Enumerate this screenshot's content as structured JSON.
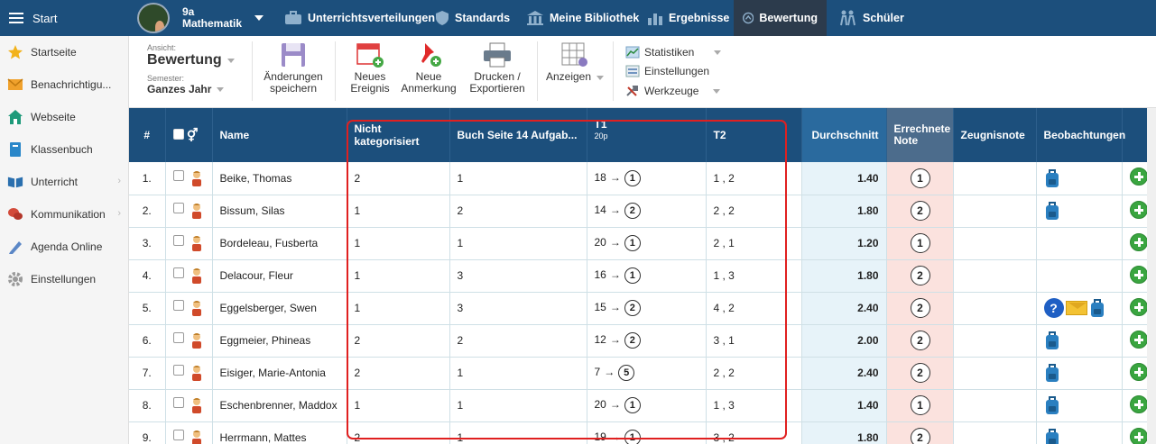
{
  "topbar": {
    "start_label": "Start",
    "class_line1": "9a",
    "class_line2": "Mathematik",
    "nav": [
      {
        "label": "Unterrichtsverteilungen",
        "icon": "briefcase-icon"
      },
      {
        "label": "Standards",
        "icon": "shield-icon"
      },
      {
        "label": "Meine Bibliothek",
        "icon": "library-icon"
      },
      {
        "label": "Ergebnisse",
        "icon": "bar-chart-icon"
      },
      {
        "label": "Bewertung",
        "icon": "gauge-icon",
        "active": true
      },
      {
        "label": "Schüler",
        "icon": "students-icon"
      }
    ]
  },
  "sidebar": {
    "items": [
      {
        "label": "Startseite",
        "icon": "star-icon"
      },
      {
        "label": "Benachrichtigu...",
        "icon": "envelope-icon"
      },
      {
        "label": "Webseite",
        "icon": "house-icon"
      },
      {
        "label": "Klassenbuch",
        "icon": "book-icon"
      },
      {
        "label": "Unterricht",
        "icon": "open-book-icon"
      },
      {
        "label": "Kommunikation",
        "icon": "chat-icon"
      },
      {
        "label": "Agenda Online",
        "icon": "pen-icon"
      },
      {
        "label": "Einstellungen",
        "icon": "gear-icon"
      }
    ]
  },
  "toolbar": {
    "ansicht_label": "Ansicht:",
    "ansicht_value": "Bewertung",
    "semester_label": "Semester:",
    "semester_value": "Ganzes Jahr",
    "save_line1": "Änderungen",
    "save_line2": "speichern",
    "event_line1": "Neues",
    "event_line2": "Ereignis",
    "note_line1": "Neue",
    "note_line2": "Anmerkung",
    "print_line1": "Drucken /",
    "print_line2": "Exportieren",
    "view_label": "Anzeigen",
    "stats_label": "Statistiken",
    "settings_label": "Einstellungen",
    "tools_label": "Werkzeuge"
  },
  "table": {
    "headers": {
      "num": "#",
      "name": "Name",
      "nk": "Nicht kategorisiert",
      "buch": "Buch Seite 14 Aufgab...",
      "t1": "T1",
      "t1_sub": "20p",
      "t2": "T2",
      "avg": "Durchschnitt",
      "calc_line1": "Errechnete",
      "calc_line2": "Note",
      "zeugnis": "Zeugnisnote",
      "beob": "Beobachtungen"
    },
    "rows": [
      {
        "num": "1.",
        "name": "Beike, Thomas",
        "nk": "2",
        "buch": "1",
        "t1_pts": "18",
        "t1_grade": "1",
        "t2": "1 , 2",
        "avg": "1.40",
        "calc": "1",
        "obs": [
          "bag"
        ]
      },
      {
        "num": "2.",
        "name": "Bissum, Silas",
        "nk": "1",
        "buch": "2",
        "t1_pts": "14",
        "t1_grade": "2",
        "t2": "2 , 2",
        "avg": "1.80",
        "calc": "2",
        "obs": [
          "bag"
        ]
      },
      {
        "num": "3.",
        "name": "Bordeleau, Fusberta",
        "nk": "1",
        "buch": "1",
        "t1_pts": "20",
        "t1_grade": "1",
        "t2": "2 , 1",
        "avg": "1.20",
        "calc": "1",
        "obs": []
      },
      {
        "num": "4.",
        "name": "Delacour, Fleur",
        "nk": "1",
        "buch": "3",
        "t1_pts": "16",
        "t1_grade": "1",
        "t2": "1 , 3",
        "avg": "1.80",
        "calc": "2",
        "obs": []
      },
      {
        "num": "5.",
        "name": "Eggelsberger, Swen",
        "nk": "1",
        "buch": "3",
        "t1_pts": "15",
        "t1_grade": "2",
        "t2": "4 , 2",
        "avg": "2.40",
        "calc": "2",
        "obs": [
          "question",
          "mail",
          "bag"
        ]
      },
      {
        "num": "6.",
        "name": "Eggmeier, Phineas",
        "nk": "2",
        "buch": "2",
        "t1_pts": "12",
        "t1_grade": "2",
        "t2": "3 , 1",
        "avg": "2.00",
        "calc": "2",
        "obs": [
          "bag"
        ]
      },
      {
        "num": "7.",
        "name": "Eisiger, Marie-Antonia",
        "nk": "2",
        "buch": "1",
        "t1_pts": "7",
        "t1_grade": "5",
        "t2": "2 , 2",
        "avg": "2.40",
        "calc": "2",
        "obs": [
          "bag"
        ]
      },
      {
        "num": "8.",
        "name": "Eschenbrenner, Maddox",
        "nk": "1",
        "buch": "1",
        "t1_pts": "20",
        "t1_grade": "1",
        "t2": "1 , 3",
        "avg": "1.40",
        "calc": "1",
        "obs": [
          "bag"
        ]
      },
      {
        "num": "9.",
        "name": "Herrmann, Mattes",
        "nk": "2",
        "buch": "1",
        "t1_pts": "19",
        "t1_grade": "1",
        "t2": "3 , 2",
        "avg": "1.80",
        "calc": "2",
        "obs": [
          "bag"
        ]
      }
    ]
  },
  "colors": {
    "nav_bg": "#1c4f7c",
    "active_nav": "#2c3b4c",
    "highlight": "#e02020",
    "avg_bg": "#e7f3f9",
    "calc_bg": "#fbe2de",
    "add_green": "#3aa540"
  }
}
